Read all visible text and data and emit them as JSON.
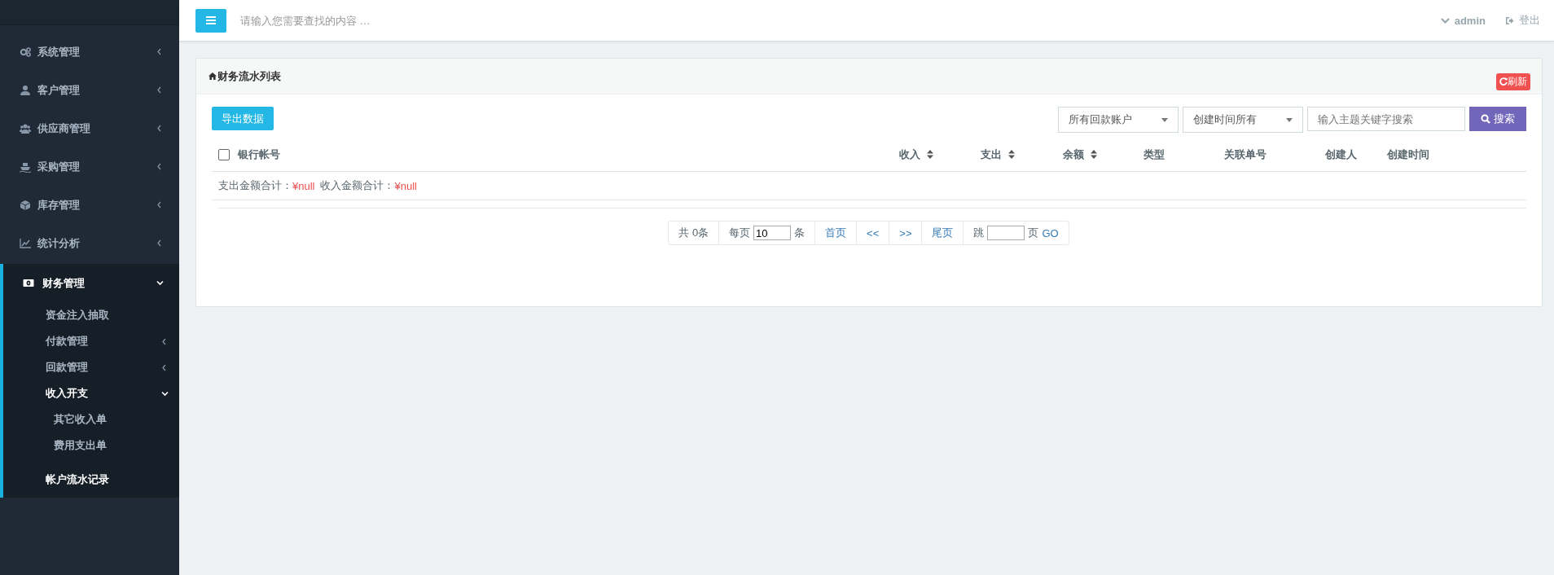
{
  "sidebar": {
    "items": [
      {
        "kind": "group",
        "label": "系统管理",
        "expanded": false,
        "selected": false
      },
      {
        "kind": "group",
        "label": "客户管理",
        "expanded": false,
        "selected": false
      },
      {
        "kind": "group",
        "label": "供应商管理",
        "expanded": false,
        "selected": false
      },
      {
        "kind": "group",
        "label": "采购管理",
        "expanded": false,
        "selected": false
      },
      {
        "kind": "group",
        "label": "库存管理",
        "expanded": false,
        "selected": false
      },
      {
        "kind": "group",
        "label": "统计分析",
        "expanded": false,
        "selected": false
      },
      {
        "kind": "group",
        "label": "财务管理",
        "expanded": true,
        "selected": true,
        "children": [
          {
            "kind": "link",
            "label": "资金注入抽取",
            "selected": false
          },
          {
            "kind": "group",
            "label": "付款管理",
            "expanded": false
          },
          {
            "kind": "group",
            "label": "回款管理",
            "expanded": false
          },
          {
            "kind": "group",
            "label": "收入开支",
            "expanded": true,
            "children": [
              {
                "kind": "link",
                "label": "其它收入单",
                "selected": false
              },
              {
                "kind": "link",
                "label": "费用支出单",
                "selected": false
              }
            ]
          },
          {
            "kind": "link",
            "label": "帐户流水记录",
            "selected": true
          }
        ]
      }
    ]
  },
  "topbar": {
    "search_placeholder": "请输入您需要查找的内容 …",
    "user": "admin",
    "logout": "登出"
  },
  "panel": {
    "title": "财务流水列表",
    "refresh": "刷新",
    "export_button": "导出数据",
    "filters": [
      {
        "value": "所有回款账户"
      },
      {
        "value": "创建时间所有"
      }
    ],
    "search": {
      "placeholder": "输入主题关键字搜索",
      "button": "搜索"
    },
    "table": {
      "select_all": {
        "checked": false
      },
      "columns": [
        {
          "label": "银行帐号",
          "sortable": false
        },
        {
          "label": "收入",
          "sortable": true
        },
        {
          "label": "支出",
          "sortable": true
        },
        {
          "label": "余额",
          "sortable": true
        },
        {
          "label": "类型",
          "sortable": false
        },
        {
          "label": "关联单号",
          "sortable": false
        },
        {
          "label": "创建人",
          "sortable": false
        },
        {
          "label": "创建时间",
          "sortable": false
        }
      ],
      "summary": [
        {
          "label": "支出金额合计：",
          "value": "¥null"
        },
        {
          "label": "收入金额合计：",
          "value": "¥null"
        }
      ]
    },
    "pagination": {
      "total": "共 0条",
      "per_page_label": "每页",
      "per_page_value": "10",
      "per_page_unit": "条",
      "first": "首页",
      "prev": "<<",
      "next": ">>",
      "last": "尾页",
      "jump_label": "跳",
      "jump_unit": "页",
      "go": "GO"
    }
  }
}
